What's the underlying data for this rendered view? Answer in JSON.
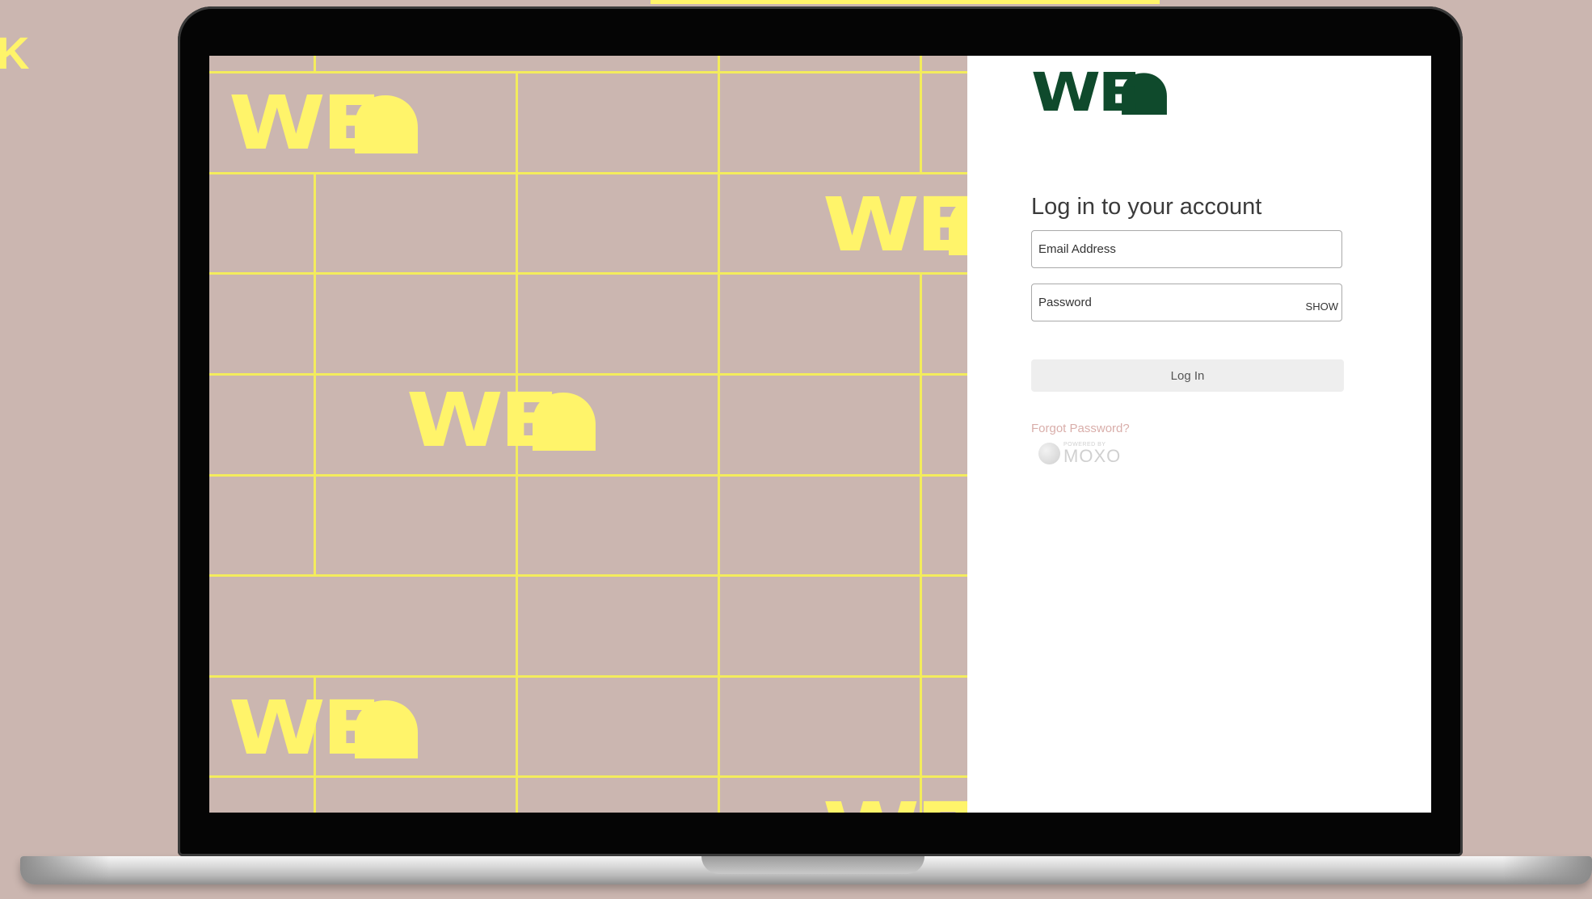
{
  "corner_mark": "K",
  "brand": {
    "wordmark": "WE",
    "primary_color": "#0f4a2c",
    "accent_color": "#fff46a",
    "panel_bg": "#cbb6b0"
  },
  "login": {
    "heading": "Log in to your account",
    "email_placeholder": "Email Address",
    "password_placeholder": "Password",
    "show_label": "SHOW",
    "submit_label": "Log In",
    "forgot_label": "Forgot Password?"
  },
  "powered_by": {
    "small": "POWERED BY",
    "name": "MOXO"
  }
}
